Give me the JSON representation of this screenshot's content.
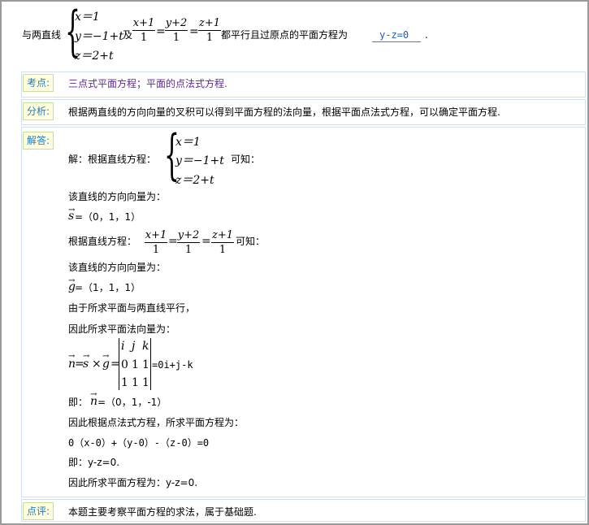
{
  "problem": {
    "prefix": "与两直线",
    "sys1": {
      "l1": "x＝1",
      "l2": "y＝−1+t",
      "l3": "z＝2+t"
    },
    "and": "及",
    "f1n": "x+1",
    "f1d": "1",
    "f2n": "y+2",
    "f2d": "1",
    "f3n": "z+1",
    "f3d": "1",
    "eq": "=",
    "suffix": "都平行且过原点的平面方程为",
    "answer": "y-z=0",
    "end": "."
  },
  "kaodian": {
    "label": "考点:",
    "text": "三点式平面方程；平面的点法式方程."
  },
  "fenxi": {
    "label": "分析:",
    "text": "根据两直线的方向向量的叉积可以得到平面方程的法向量，根据平面点法式方程，可以确定平面方程."
  },
  "jieda": {
    "label": "解答:",
    "line1": "解：根据直线方程：",
    "line1_tail": "可知：",
    "sys": {
      "l1": "x＝1",
      "l2": "y＝−1+t",
      "l3": "z＝2+t"
    },
    "line2": "该直线的方向向量为：",
    "s_vec_var": "s",
    "s_vec": "=（0，1，1）",
    "line4": "根据直线方程：",
    "line4_tail": "可知：",
    "line5": "该直线的方向向量为：",
    "g_vec_var": "g",
    "g_vec": "=（1，1，1）",
    "line7": "由于所求平面与两直线平行，",
    "line8": "因此所求平面法向量为：",
    "n_var": "n",
    "eq_sign": "=",
    "times": "×",
    "det": {
      "r1": [
        "i",
        "j",
        "k"
      ],
      "r2": [
        "0",
        "1",
        "1"
      ],
      "r3": [
        "1",
        "1",
        "1"
      ]
    },
    "det_result": "=0i+j-k",
    "line10a": "即：",
    "line10b": "=（0，1，-1）",
    "line11": "因此根据点法式方程，所求平面方程为：",
    "line12": "0（x-0）+（y-0）-（z-0）=0",
    "line13": "即：y-z=0.",
    "line14": "因此所求平面方程为：y-z=0."
  },
  "dianping": {
    "label": "点评:",
    "text": "本题主要考察平面方程的求法，属于基础题."
  },
  "colors": {
    "tag_bg": "#ffffe0",
    "tag_border": "#c6df9a",
    "tag_text": "#1f7ac0",
    "kaodian_text": "#5b2b8f",
    "answer": "#1f5fbf"
  }
}
